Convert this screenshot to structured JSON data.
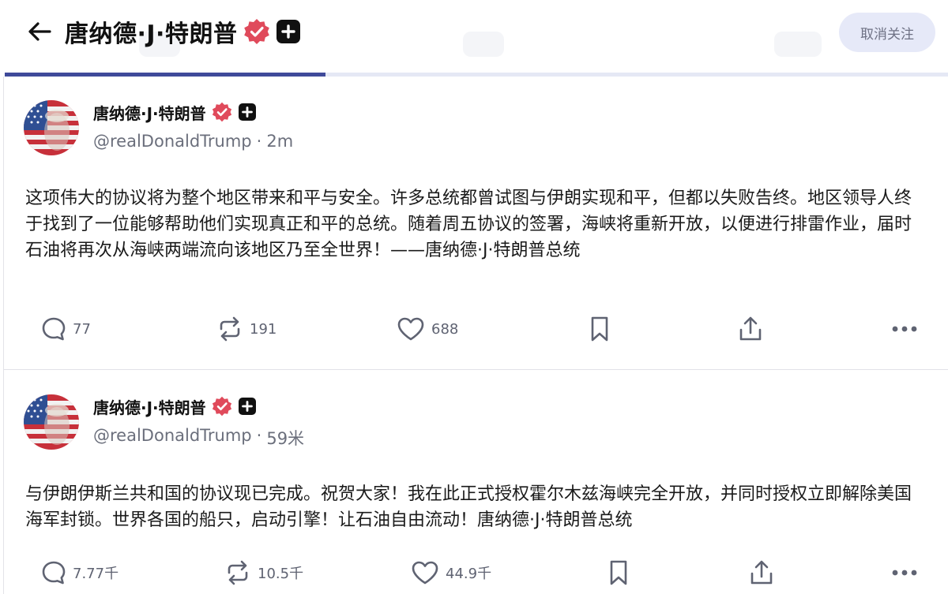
{
  "header": {
    "title": "唐纳德·J·特朗普",
    "unfollow_label": "取消关注",
    "progress_fraction": 0.34
  },
  "colors": {
    "verified_badge": "#e04a5b",
    "accent_progress": "#3f4a9a",
    "button_bg": "#e6e9f8"
  },
  "posts": [
    {
      "author": "唐纳德·J·特朗普",
      "handle": "@realDonaldTrump",
      "separator": "·",
      "time": "2m",
      "text": "这项伟大的协议将为整个地区带来和平与安全。许多总统都曾试图与伊朗实现和平，但都以失败告终。地区领导人终于找到了一位能够帮助他们实现真正和平的总统。随着周五协议的签署，海峡将重新开放，以便进行排雷作业，届时石油将再次从海峡两端流向该地区乃至全世界！——唐纳德·J·特朗普总统",
      "replies": "77",
      "reposts": "191",
      "likes": "688"
    },
    {
      "author": "唐纳德·J·特朗普",
      "handle": "@realDonaldTrump",
      "separator": "·",
      "time": "59米",
      "text": "与伊朗伊斯兰共和国的协议现已完成。祝贺大家！我在此正式授权霍尔木兹海峡完全开放，并同时授权立即解除美国海军封锁。世界各国的船只，启动引擎！让石油自由流动！唐纳德·J·特朗普总统",
      "replies": "7.77千",
      "reposts": "10.5千",
      "likes": "44.9千"
    }
  ],
  "icons": [
    "back-arrow-icon",
    "verified-badge-icon",
    "plus-badge-icon",
    "reply-icon",
    "repost-icon",
    "like-icon",
    "bookmark-icon",
    "share-icon",
    "more-icon"
  ]
}
